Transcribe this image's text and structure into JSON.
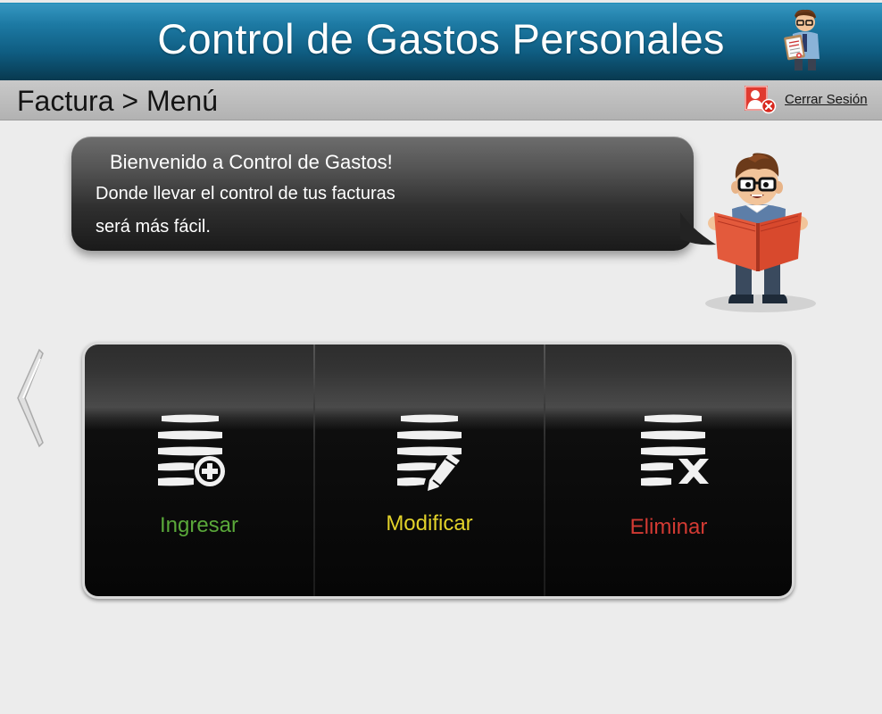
{
  "header": {
    "title": "Control de Gastos Personales"
  },
  "subbar": {
    "breadcrumb": "Factura > Menú",
    "logout_label": "Cerrar Sesión"
  },
  "welcome": {
    "title": "Bienvenido a Control de Gastos!",
    "line1": "Donde llevar el control de tus facturas",
    "line2": "será más fácil."
  },
  "menu": {
    "items": [
      {
        "label": "Ingresar",
        "icon": "add-document-icon",
        "color": "#5aa83a"
      },
      {
        "label": "Modificar",
        "icon": "edit-document-icon",
        "color": "#e2d22a"
      },
      {
        "label": "Eliminar",
        "icon": "delete-document-icon",
        "color": "#d23a33"
      }
    ]
  },
  "colors": {
    "header": "#1d7aa4",
    "background": "#ececec"
  }
}
